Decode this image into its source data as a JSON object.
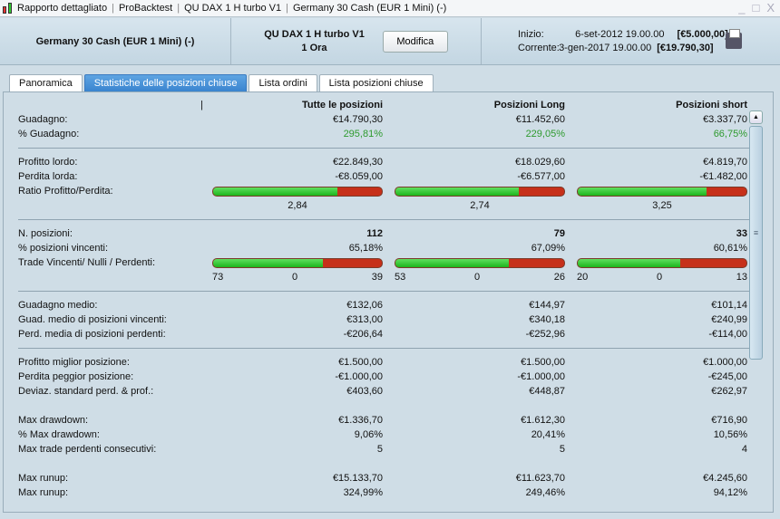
{
  "titlebar": {
    "items": [
      "Rapporto dettagliato",
      "ProBacktest",
      "QU  DAX 1 H turbo V1",
      "Germany 30 Cash (EUR 1 Mini) (-)"
    ]
  },
  "header": {
    "instrument": "Germany 30 Cash (EUR 1 Mini) (-)",
    "strategy": "QU  DAX 1 H turbo V1",
    "timeframe": "1 Ora",
    "edit_label": "Modifica",
    "start_label": "Inizio:",
    "start_date": "6-set-2012 19.00.00",
    "start_capital": "[€5.000,00]",
    "current_label": "Corrente:",
    "current_date": "3-gen-2017 19.00.00",
    "current_capital": "[€19.790,30]"
  },
  "tabs": [
    {
      "label": "Panoramica"
    },
    {
      "label": "Statistiche delle posizioni chiuse",
      "active": true
    },
    {
      "label": "Lista ordini"
    },
    {
      "label": "Lista posizioni chiuse"
    }
  ],
  "columns": [
    "Tutte le posizioni",
    "Posizioni Long",
    "Posizioni short"
  ],
  "rows": [
    {
      "type": "val",
      "label": "Guadagno:",
      "values": [
        "€14.790,30",
        "€11.452,60",
        "€3.337,70"
      ]
    },
    {
      "type": "val",
      "label": "% Guadagno:",
      "values": [
        "295,81%",
        "229,05%",
        "66,75%"
      ],
      "style": "green"
    },
    {
      "type": "sep"
    },
    {
      "type": "val",
      "label": "Profitto lordo:",
      "values": [
        "€22.849,30",
        "€18.029,60",
        "€4.819,70"
      ]
    },
    {
      "type": "val",
      "label": "Perdita lorda:",
      "values": [
        "-€8.059,00",
        "-€6.577,00",
        "-€1.482,00"
      ]
    },
    {
      "type": "bar",
      "label": "Ratio Profitto/Perdita:",
      "fractions": [
        0.739,
        0.733,
        0.765
      ]
    },
    {
      "type": "barval",
      "values": [
        "2,84",
        "2,74",
        "3,25"
      ]
    },
    {
      "type": "sep"
    },
    {
      "type": "val",
      "label": "N. posizioni:",
      "values": [
        "112",
        "79",
        "33"
      ],
      "style": "bold"
    },
    {
      "type": "val",
      "label": "% posizioni vincenti:",
      "values": [
        "65,18%",
        "67,09%",
        "60,61%"
      ]
    },
    {
      "type": "bar",
      "label": "Trade Vincenti/ Nulli / Perdenti:",
      "fractions": [
        0.6518,
        0.6709,
        0.6061
      ]
    },
    {
      "type": "trade",
      "values": [
        [
          "73",
          "0",
          "39"
        ],
        [
          "53",
          "0",
          "26"
        ],
        [
          "20",
          "0",
          "13"
        ]
      ]
    },
    {
      "type": "sep"
    },
    {
      "type": "val",
      "label": "Guadagno medio:",
      "values": [
        "€132,06",
        "€144,97",
        "€101,14"
      ]
    },
    {
      "type": "val",
      "label": "Guad. medio di posizioni vincenti:",
      "values": [
        "€313,00",
        "€340,18",
        "€240,99"
      ]
    },
    {
      "type": "val",
      "label": "Perd. media di posizioni perdenti:",
      "values": [
        "-€206,64",
        "-€252,96",
        "-€114,00"
      ]
    },
    {
      "type": "sep"
    },
    {
      "type": "val",
      "label": "Profitto miglior posizione:",
      "values": [
        "€1.500,00",
        "€1.500,00",
        "€1.000,00"
      ]
    },
    {
      "type": "val",
      "label": "Perdita peggior posizione:",
      "values": [
        "-€1.000,00",
        "-€1.000,00",
        "-€245,00"
      ]
    },
    {
      "type": "val",
      "label": "Deviaz. standard perd. & prof.:",
      "values": [
        "€403,60",
        "€448,87",
        "€262,97"
      ]
    },
    {
      "type": "gap"
    },
    {
      "type": "val",
      "label": "Max drawdown:",
      "values": [
        "€1.336,70",
        "€1.612,30",
        "€716,90"
      ]
    },
    {
      "type": "val",
      "label": "% Max drawdown:",
      "values": [
        "9,06%",
        "20,41%",
        "10,56%"
      ]
    },
    {
      "type": "val",
      "label": "Max trade perdenti consecutivi:",
      "values": [
        "5",
        "5",
        "4"
      ]
    },
    {
      "type": "gap"
    },
    {
      "type": "val",
      "label": "Max runup:",
      "values": [
        "€15.133,70",
        "€11.623,70",
        "€4.245,60"
      ]
    },
    {
      "type": "val",
      "label": "Max runup:",
      "values": [
        "324,99%",
        "249,46%",
        "94,12%"
      ]
    }
  ]
}
